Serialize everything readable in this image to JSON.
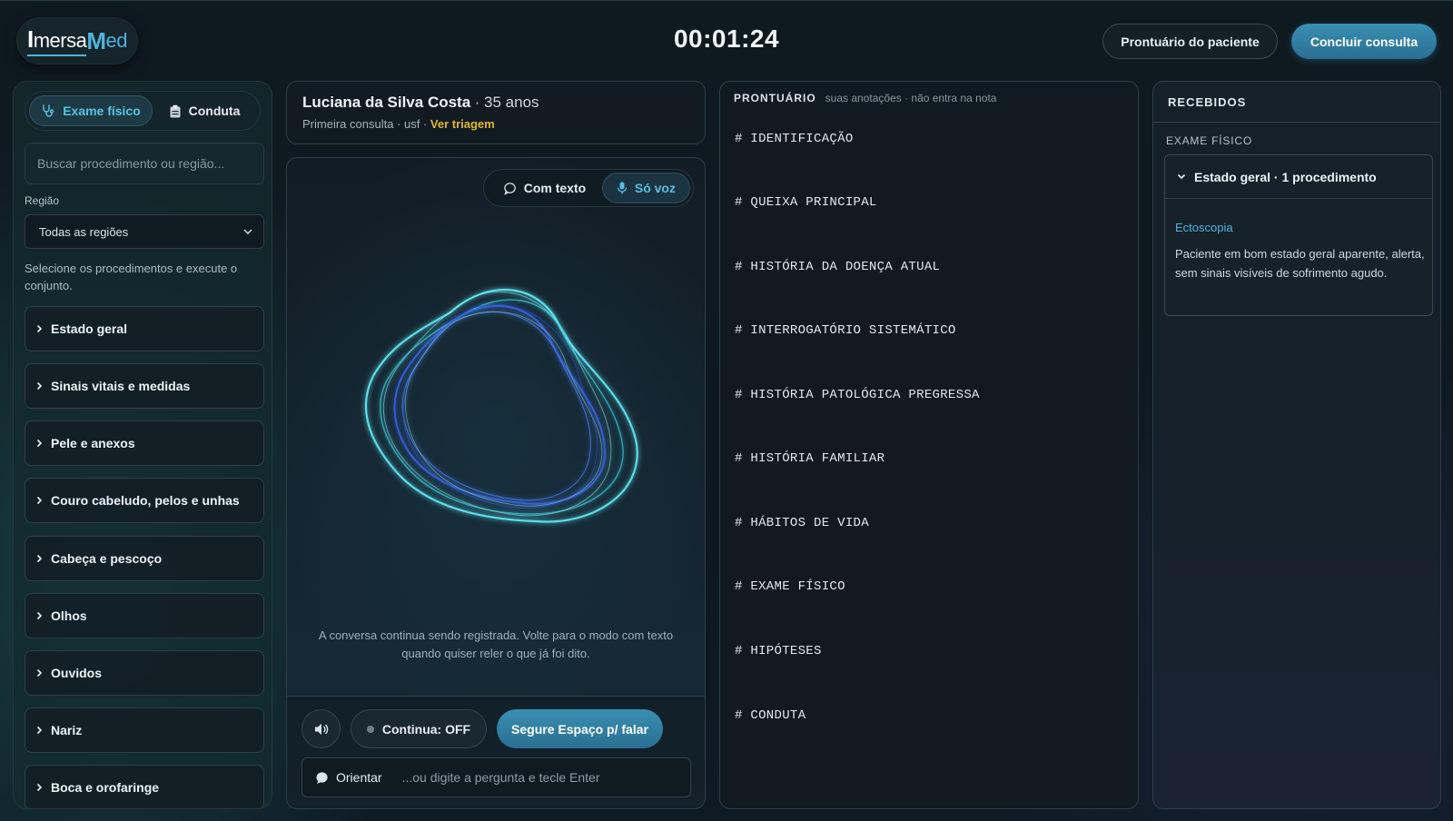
{
  "header": {
    "logo": {
      "part1": "I",
      "part2": "mersa",
      "part3": "M",
      "part4": "ed"
    },
    "timer": "00:01:24",
    "patient_record_button": "Prontuário do paciente",
    "finish_button": "Concluir consulta"
  },
  "left_panel": {
    "tabs": [
      {
        "label": "Exame físico",
        "icon": "stethoscope-icon",
        "active": true
      },
      {
        "label": "Conduta",
        "icon": "clipboard-icon",
        "active": false
      }
    ],
    "search": {
      "placeholder": "Buscar procedimento ou região..."
    },
    "region_label": "Região",
    "region_select": {
      "value": "Todas as regiões"
    },
    "hint": "Selecione os procedimentos e execute o conjunto.",
    "sections": [
      "Estado geral",
      "Sinais vitais e medidas",
      "Pele e anexos",
      "Couro cabeludo, pelos e unhas",
      "Cabeça e pescoço",
      "Olhos",
      "Ouvidos",
      "Nariz",
      "Boca e orofaringe"
    ]
  },
  "patient": {
    "name": "Luciana da Silva Costa",
    "age": "· 35 anos",
    "subtitle": "Primeira consulta · usf ·",
    "triage_link": "Ver triagem"
  },
  "voice": {
    "mode_text": "Com texto",
    "mode_voice": "Só voz",
    "note": "A conversa continua sendo registrada. Volte para o modo com texto quando quiser reler o que já foi dito.",
    "continuous": "Continua: OFF",
    "push_to_talk": "Segure Espaço p/ falar",
    "ask_label": "Orientar",
    "ask_placeholder": "...ou digite a pergunta e tecle Enter"
  },
  "prontuario": {
    "title": "PRONTUÁRIO",
    "subtitle": "suas anotações · não entra na nota",
    "sections": [
      "# IDENTIFICAÇÃO",
      "# QUEIXA PRINCIPAL",
      "# HISTÓRIA DA DOENÇA ATUAL",
      "# INTERROGATÓRIO SISTEMÁTICO",
      "# HISTÓRIA PATOLÓGICA PREGRESSA",
      "# HISTÓRIA FAMILIAR",
      "# HÁBITOS DE VIDA",
      "# EXAME FÍSICO",
      "# HIPÓTESES",
      "# CONDUTA"
    ]
  },
  "received": {
    "title": "RECEBIDOS",
    "group": "EXAME FÍSICO",
    "card_title": "Estado geral · 1 procedimento",
    "procedure": "Ectoscopia",
    "text": "Paciente em bom estado geral aparente, alerta, sem sinais visíveis de sofrimento agudo."
  },
  "colors": {
    "accent": "#4fb3d9",
    "primary_button": "#3a8fb3",
    "link": "#e2b62f"
  }
}
